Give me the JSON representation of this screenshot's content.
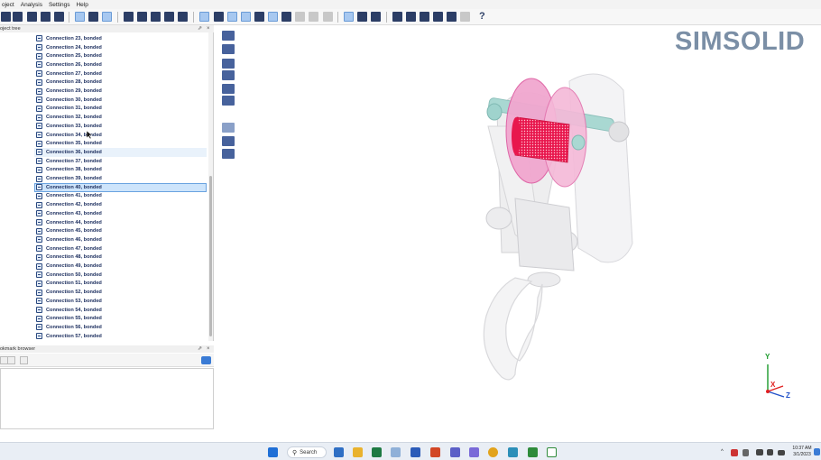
{
  "menu": [
    "oject",
    "Analysis",
    "Settings",
    "Help"
  ],
  "toolbar": {
    "help_label": "?"
  },
  "project_tree": {
    "title": "oject tree",
    "items": [
      "Connection 23, bonded",
      "Connection 24, bonded",
      "Connection 25, bonded",
      "Connection 26, bonded",
      "Connection 27, bonded",
      "Connection 28, bonded",
      "Connection 29, bonded",
      "Connection 30, bonded",
      "Connection 31, bonded",
      "Connection 32, bonded",
      "Connection 33, bonded",
      "Connection 34, bonded",
      "Connection 35, bonded",
      "Connection 36, bonded",
      "Connection 37, bonded",
      "Connection 38, bonded",
      "Connection 39, bonded",
      "Connection 40, bonded",
      "Connection 41, bonded",
      "Connection 42, bonded",
      "Connection 43, bonded",
      "Connection 44, bonded",
      "Connection 45, bonded",
      "Connection 46, bonded",
      "Connection 47, bonded",
      "Connection 48, bonded",
      "Connection 49, bonded",
      "Connection 50, bonded",
      "Connection 51, bonded",
      "Connection 52, bonded",
      "Connection 53, bonded",
      "Connection 54, bonded",
      "Connection 55, bonded",
      "Connection 56, bonded",
      "Connection 57, bonded"
    ],
    "selected_index": 17,
    "hover_index": 13
  },
  "bookmark_browser": {
    "title": "okmark browser"
  },
  "panel_controls": {
    "float": "⇗",
    "close": "×"
  },
  "viewport": {
    "logo": "SIMSOLID",
    "axes": {
      "x": "X",
      "y": "Y",
      "z": "Z"
    },
    "colors": {
      "x": "#e02020",
      "y": "#1a9a2a",
      "z": "#2050c8",
      "highlight": "#e0247a",
      "roller": "#e8174d"
    }
  },
  "taskbar": {
    "search_label": "Search",
    "time": "10:37 AM",
    "date": "3/1/2023"
  }
}
